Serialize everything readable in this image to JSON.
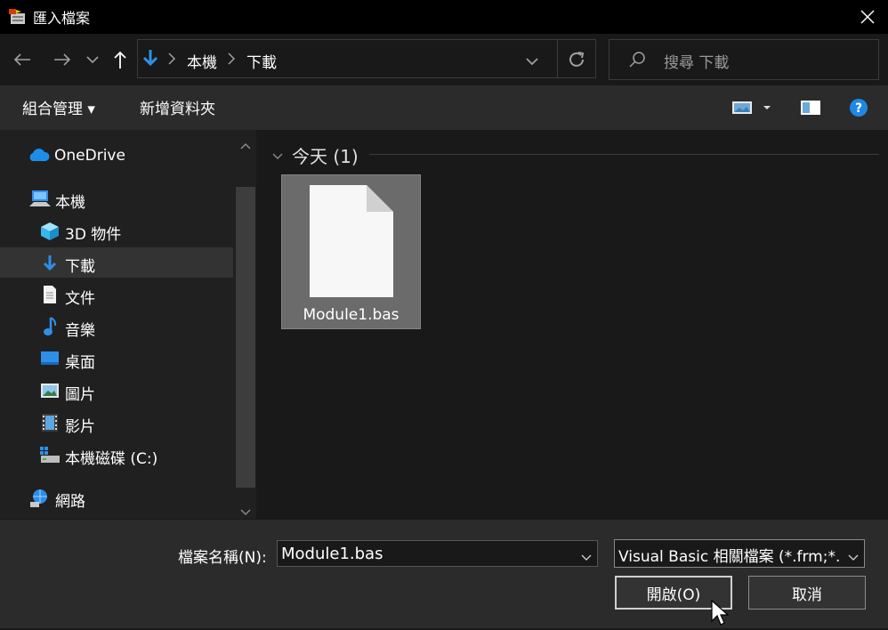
{
  "window": {
    "title": "匯入檔案"
  },
  "address": {
    "crumbs": [
      "本機",
      "下載"
    ]
  },
  "search": {
    "placeholder": "搜尋 下載"
  },
  "toolbar": {
    "organize": "組合管理 ▾",
    "new_folder": "新增資料夾"
  },
  "sidebar": {
    "items": [
      {
        "label": "OneDrive",
        "icon": "cloud-icon"
      },
      {
        "label": "本機",
        "icon": "computer-icon"
      },
      {
        "label": "3D 物件",
        "icon": "cube-icon"
      },
      {
        "label": "下載",
        "icon": "download-arrow-icon",
        "selected": true
      },
      {
        "label": "文件",
        "icon": "document-icon"
      },
      {
        "label": "音樂",
        "icon": "music-note-icon"
      },
      {
        "label": "桌面",
        "icon": "desktop-icon"
      },
      {
        "label": "圖片",
        "icon": "picture-icon"
      },
      {
        "label": "影片",
        "icon": "film-icon"
      },
      {
        "label": "本機磁碟 (C:)",
        "icon": "drive-icon"
      },
      {
        "label": "網路",
        "icon": "network-icon"
      }
    ]
  },
  "content": {
    "group_header": "今天 (1)",
    "files": [
      {
        "name": "Module1.bas",
        "icon": "blank-file-icon"
      }
    ]
  },
  "footer": {
    "filename_label": "檔案名稱(N):",
    "filename_value": "Module1.bas",
    "filetype_value": "Visual Basic 相關檔案 (*.frm;*.bas;*.cls)",
    "open_label": "開啟(O)",
    "cancel_label": "取消"
  },
  "colors": {
    "accent": "#0078d7",
    "help": "#1e88e5",
    "selected": "#333333"
  }
}
